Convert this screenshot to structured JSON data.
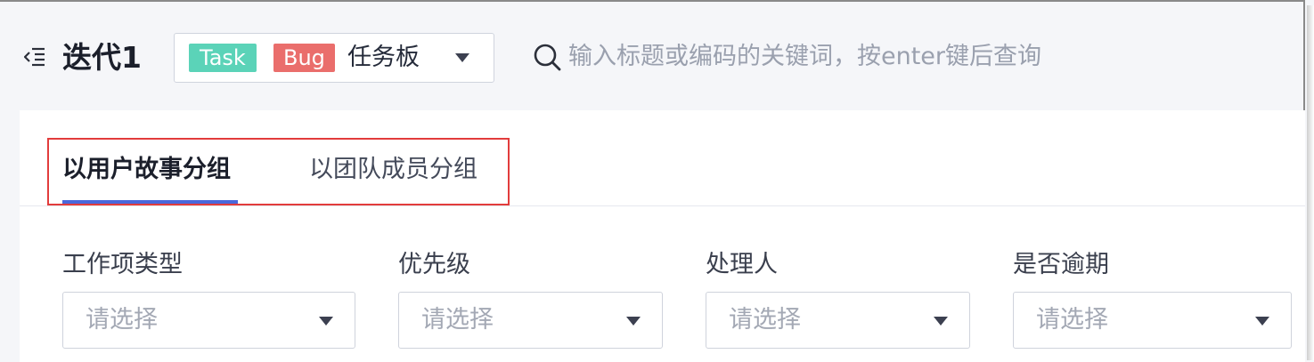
{
  "header": {
    "title": "迭代1",
    "board_tags": [
      {
        "label": "Task",
        "color": "#5bd3b8"
      },
      {
        "label": "Bug",
        "color": "#ea6e6c"
      }
    ],
    "board_label": "任务板",
    "search_placeholder": "输入标题或编码的关键词，按enter键后查询"
  },
  "tabs": {
    "active": "以用户故事分组",
    "inactive": "以团队成员分组",
    "highlight_color": "#e23c3c",
    "underline_color": "#4a68db"
  },
  "filters": [
    {
      "label": "工作项类型",
      "placeholder": "请选择"
    },
    {
      "label": "优先级",
      "placeholder": "请选择"
    },
    {
      "label": "处理人",
      "placeholder": "请选择"
    },
    {
      "label": "是否逾期",
      "placeholder": "请选择"
    }
  ]
}
